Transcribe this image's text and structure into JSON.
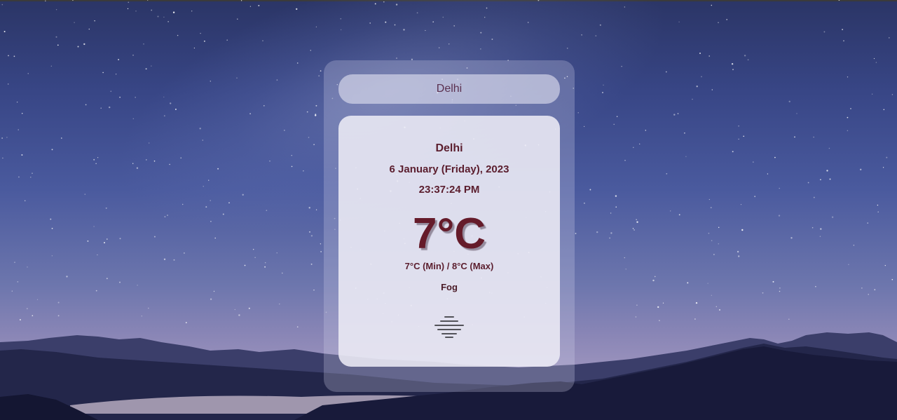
{
  "search": {
    "placeholder": "Delhi"
  },
  "weather": {
    "city": "Delhi",
    "date": "6 January (Friday), 2023",
    "time": "23:37:24 PM",
    "temperature": "7°C",
    "min_max": "7°C (Min) / 8°C (Max)",
    "condition": "Fog",
    "icon": "fog-icon"
  },
  "colors": {
    "text_primary": "#5b1e2e",
    "temperature": "#651b2a",
    "sky_top": "#2b3566",
    "sky_bottom": "#b8a8c4"
  }
}
